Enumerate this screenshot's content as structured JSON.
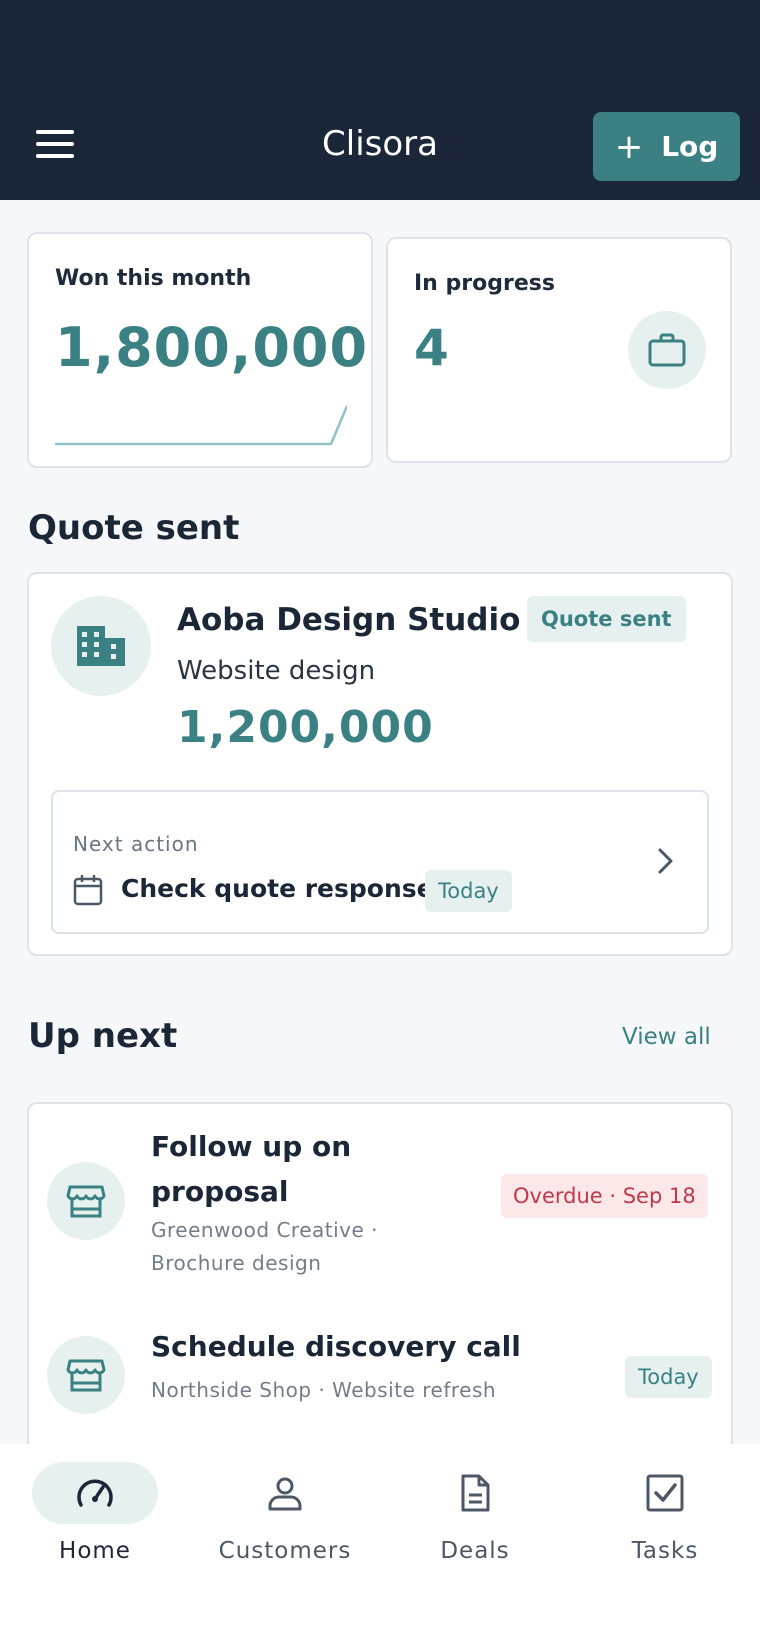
{
  "app": {
    "title": "Clisora",
    "log_button": "Log",
    "colors": {
      "header": "#1b2739",
      "accent": "#3b8183",
      "accent_soft": "#e6f1ef",
      "danger": "#c0394a",
      "danger_soft": "#fce8e8"
    }
  },
  "stats": {
    "won": {
      "label": "Won this month",
      "value": "1,800,000"
    },
    "progress": {
      "label": "In progress",
      "value": "4",
      "icon": "briefcase-icon"
    }
  },
  "quote": {
    "section_title": "Quote sent",
    "company": "Aoba Design Studio",
    "status": "Quote sent",
    "deal": "Website design",
    "value": "1,200,000",
    "next_action": {
      "label": "Next action",
      "title": "Check quote response",
      "due": "Today"
    }
  },
  "up_next": {
    "section_title": "Up next",
    "view_all": "View all",
    "tasks": [
      {
        "title_line1": "Follow up on",
        "title_line2": "proposal",
        "sub_line1": "Greenwood Creative ·",
        "sub_line2": "Brochure design",
        "badge": "Overdue · Sep 18",
        "badge_type": "overdue"
      },
      {
        "title": "Schedule discovery call",
        "sub": "Northside Shop · Website refresh",
        "badge": "Today",
        "badge_type": "today"
      }
    ]
  },
  "nav": {
    "items": [
      {
        "label": "Home",
        "icon": "speedometer-icon",
        "active": true
      },
      {
        "label": "Customers",
        "icon": "person-icon"
      },
      {
        "label": "Deals",
        "icon": "document-icon"
      },
      {
        "label": "Tasks",
        "icon": "checkbox-icon"
      }
    ]
  }
}
